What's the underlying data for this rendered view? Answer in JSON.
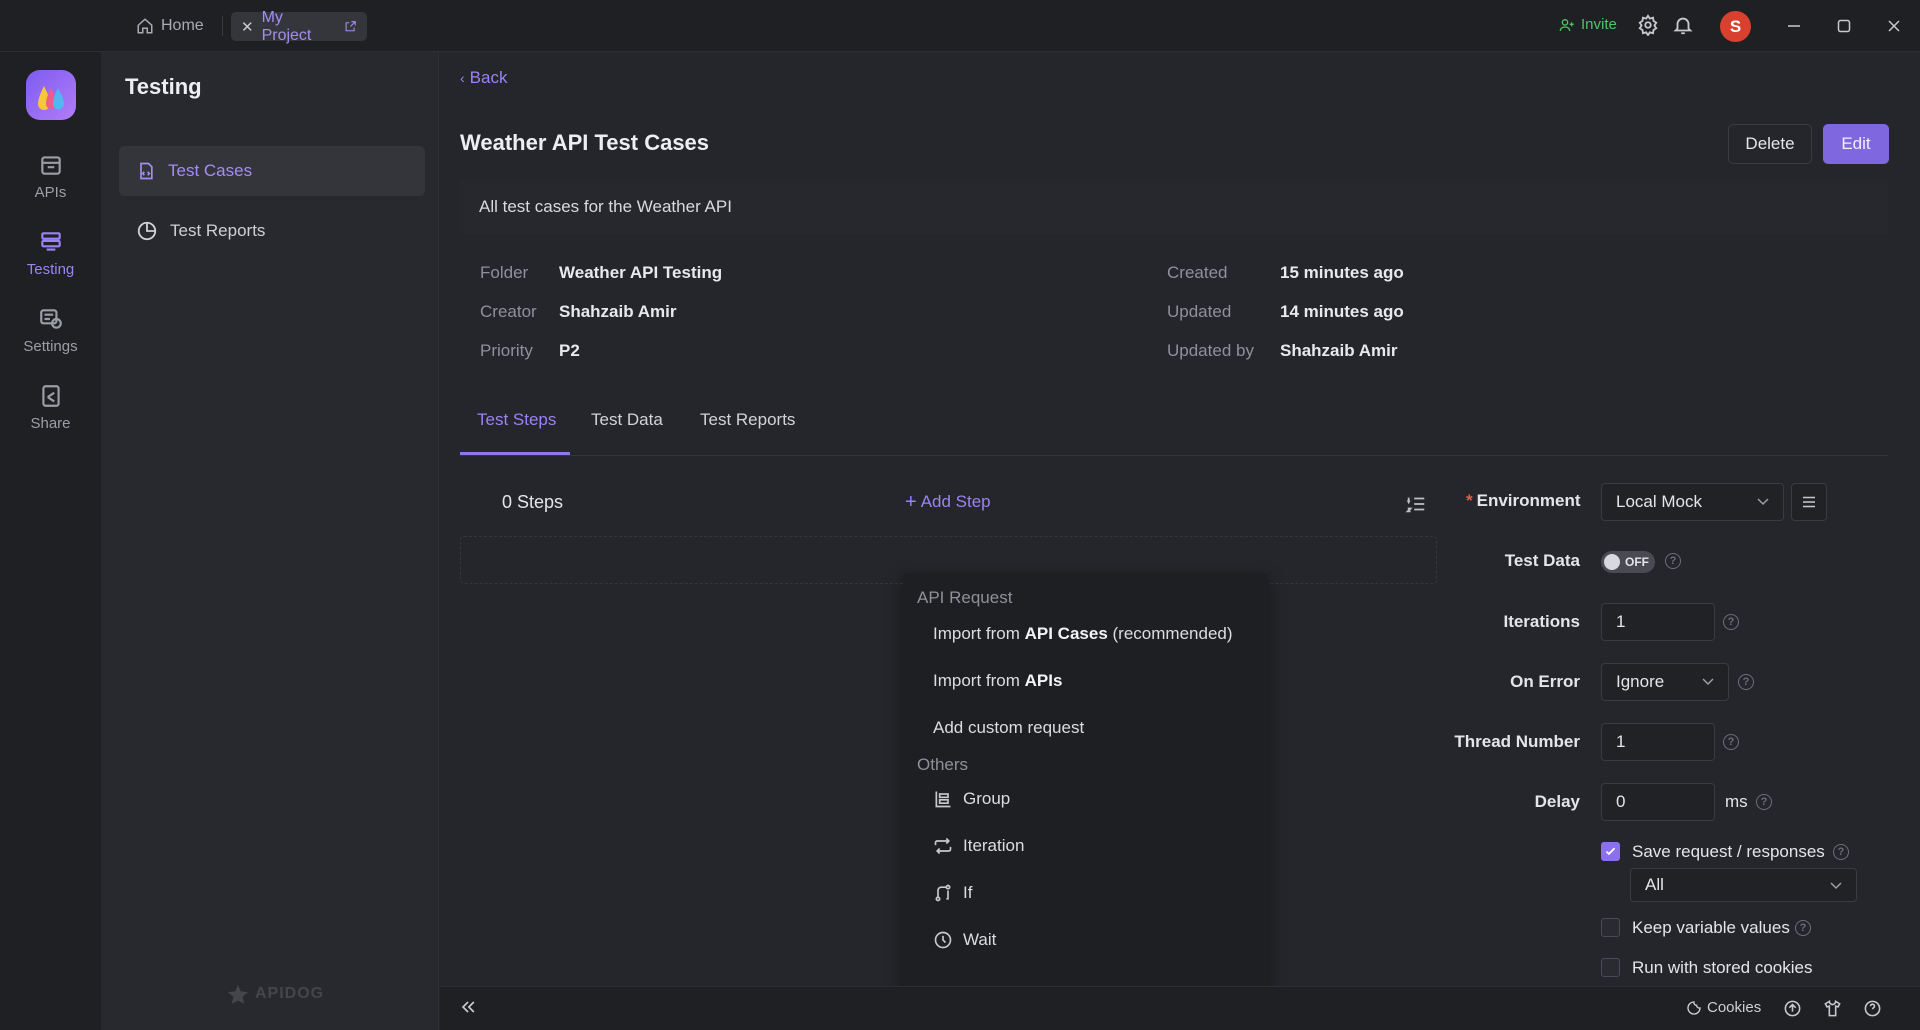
{
  "topbar": {
    "home_tab": "Home",
    "project_tab": "My Project",
    "invite": "Invite",
    "avatar_initial": "S"
  },
  "rail": {
    "items": [
      {
        "label": "APIs",
        "icon": "apis-icon"
      },
      {
        "label": "Testing",
        "icon": "testing-icon"
      },
      {
        "label": "Settings",
        "icon": "settings-icon"
      },
      {
        "label": "Share",
        "icon": "share-icon"
      }
    ]
  },
  "sidebar": {
    "title": "Testing",
    "items": [
      {
        "label": "Test Cases",
        "icon": "test-cases-icon"
      },
      {
        "label": "Test Reports",
        "icon": "test-reports-icon"
      }
    ],
    "brand": "APIDOG"
  },
  "main": {
    "back": "Back",
    "title": "Weather API Test Cases",
    "delete": "Delete",
    "edit": "Edit",
    "description": "All test cases for the Weather API",
    "meta": {
      "folder_label": "Folder",
      "folder": "Weather API Testing",
      "creator_label": "Creator",
      "creator": "Shahzaib Amir",
      "priority_label": "Priority",
      "priority": "P2",
      "created_label": "Created",
      "created": "15 minutes ago",
      "updated_label": "Updated",
      "updated": "14 minutes ago",
      "updated_by_label": "Updated by",
      "updated_by": "Shahzaib Amir"
    },
    "tabs": [
      "Test Steps",
      "Test Data",
      "Test Reports"
    ],
    "active_tab": "Test Steps",
    "steps_count": "0 Steps",
    "add_step": "Add Step"
  },
  "menu": {
    "api_group": "API Request",
    "import_api_cases_prefix": "Import from ",
    "import_api_cases_bold": "API Cases",
    "import_api_cases_suffix": " (recommended)",
    "import_apis_prefix": "Import from ",
    "import_apis_bold": "APIs",
    "custom_request": "Add custom request",
    "others_group": "Others",
    "group": "Group",
    "iteration": "Iteration",
    "if": "If",
    "wait": "Wait"
  },
  "settings": {
    "environment_label": "Environment",
    "environment_value": "Local Mock",
    "test_data_label": "Test Data",
    "test_data_toggle": "OFF",
    "iterations_label": "Iterations",
    "iterations_value": "1",
    "on_error_label": "On Error",
    "on_error_value": "Ignore",
    "thread_label": "Thread Number",
    "thread_value": "1",
    "delay_label": "Delay",
    "delay_value": "0",
    "delay_unit": "ms",
    "save_req_label": "Save request / responses",
    "save_req_checked": true,
    "save_scope": "All",
    "keep_vars_label": "Keep variable values",
    "stored_cookies_label": "Run with stored cookies"
  },
  "bottombar": {
    "cookies": "Cookies"
  },
  "colors": {
    "accent": "#8f76ec",
    "invite": "#4fc466",
    "avatar": "#d8412e",
    "required": "#e65b50"
  }
}
